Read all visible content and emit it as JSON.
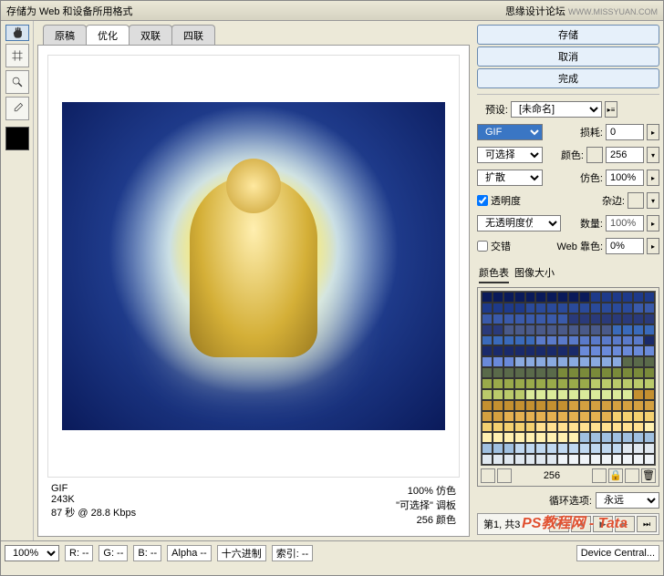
{
  "titlebar": {
    "title": "存储为 Web 和设备所用格式",
    "brand": "思缘设计论坛",
    "url": "WWW.MISSYUAN.COM"
  },
  "tools": {
    "items": [
      "hand",
      "slice",
      "zoom",
      "eyedropper"
    ]
  },
  "tabs": {
    "items": [
      "原稿",
      "优化",
      "双联",
      "四联"
    ],
    "activeIndex": 1
  },
  "preview": {
    "left1": "GIF",
    "left2": "243K",
    "left3": "87 秒 @ 28.8 Kbps",
    "right1": "100% 仿色",
    "right2": "\"可选择\" 调板",
    "right3": "256 颜色"
  },
  "buttons": {
    "save": "存储",
    "cancel": "取消",
    "done": "完成"
  },
  "settings": {
    "presetLabel": "预设:",
    "presetValue": "[未命名]",
    "format": "GIF",
    "lossyLabel": "损耗:",
    "lossyValue": "0",
    "reduction": "可选择",
    "colorsLabel": "颜色:",
    "colorsValue": "256",
    "dither": "扩散",
    "ditherLabel": "仿色:",
    "ditherValue": "100%",
    "transparency": "透明度",
    "matteLabel": "杂边:",
    "noTransDither": "无透明度仿色",
    "amountLabel": "数量:",
    "amountValue": "100%",
    "interlace": "交错",
    "webLabel": "Web 靠色:",
    "webValue": "0%"
  },
  "paletteTabs": {
    "items": [
      "颜色表",
      "图像大小"
    ],
    "activeIndex": 0
  },
  "paletteFoot": {
    "count": "256"
  },
  "loop": {
    "label": "循环选项:",
    "value": "永远"
  },
  "anim": {
    "frame": "第1, 共3"
  },
  "status": {
    "zoom": "100%",
    "r": "R: --",
    "g": "G: --",
    "b": "B: --",
    "alpha": "Alpha --",
    "hex": "十六进制",
    "index": "索引: --",
    "device": "Device Central..."
  },
  "watermark": "PS教程网 - Tata"
}
